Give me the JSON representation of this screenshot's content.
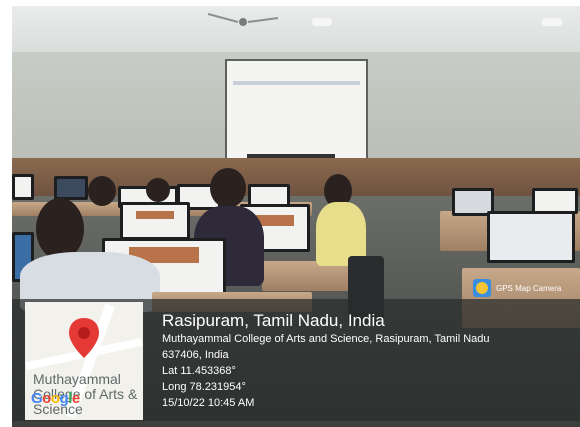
{
  "overlay": {
    "title": "Rasipuram, Tamil Nadu, India",
    "address_line1": "Muthayammal College of Arts and Science, Rasipuram, Tamil Nadu",
    "address_line2": "637406, India",
    "lat": "Lat 11.453368°",
    "long": "Long 78.231954°",
    "datetime": "15/10/22 10:45 AM"
  },
  "map": {
    "label": "Muthayammal College of Arts & Science",
    "brand": "Google",
    "pin_color": "#e53935"
  },
  "gps_badge": {
    "text": "GPS Map Camera",
    "icon": "gps-map-camera-icon"
  }
}
